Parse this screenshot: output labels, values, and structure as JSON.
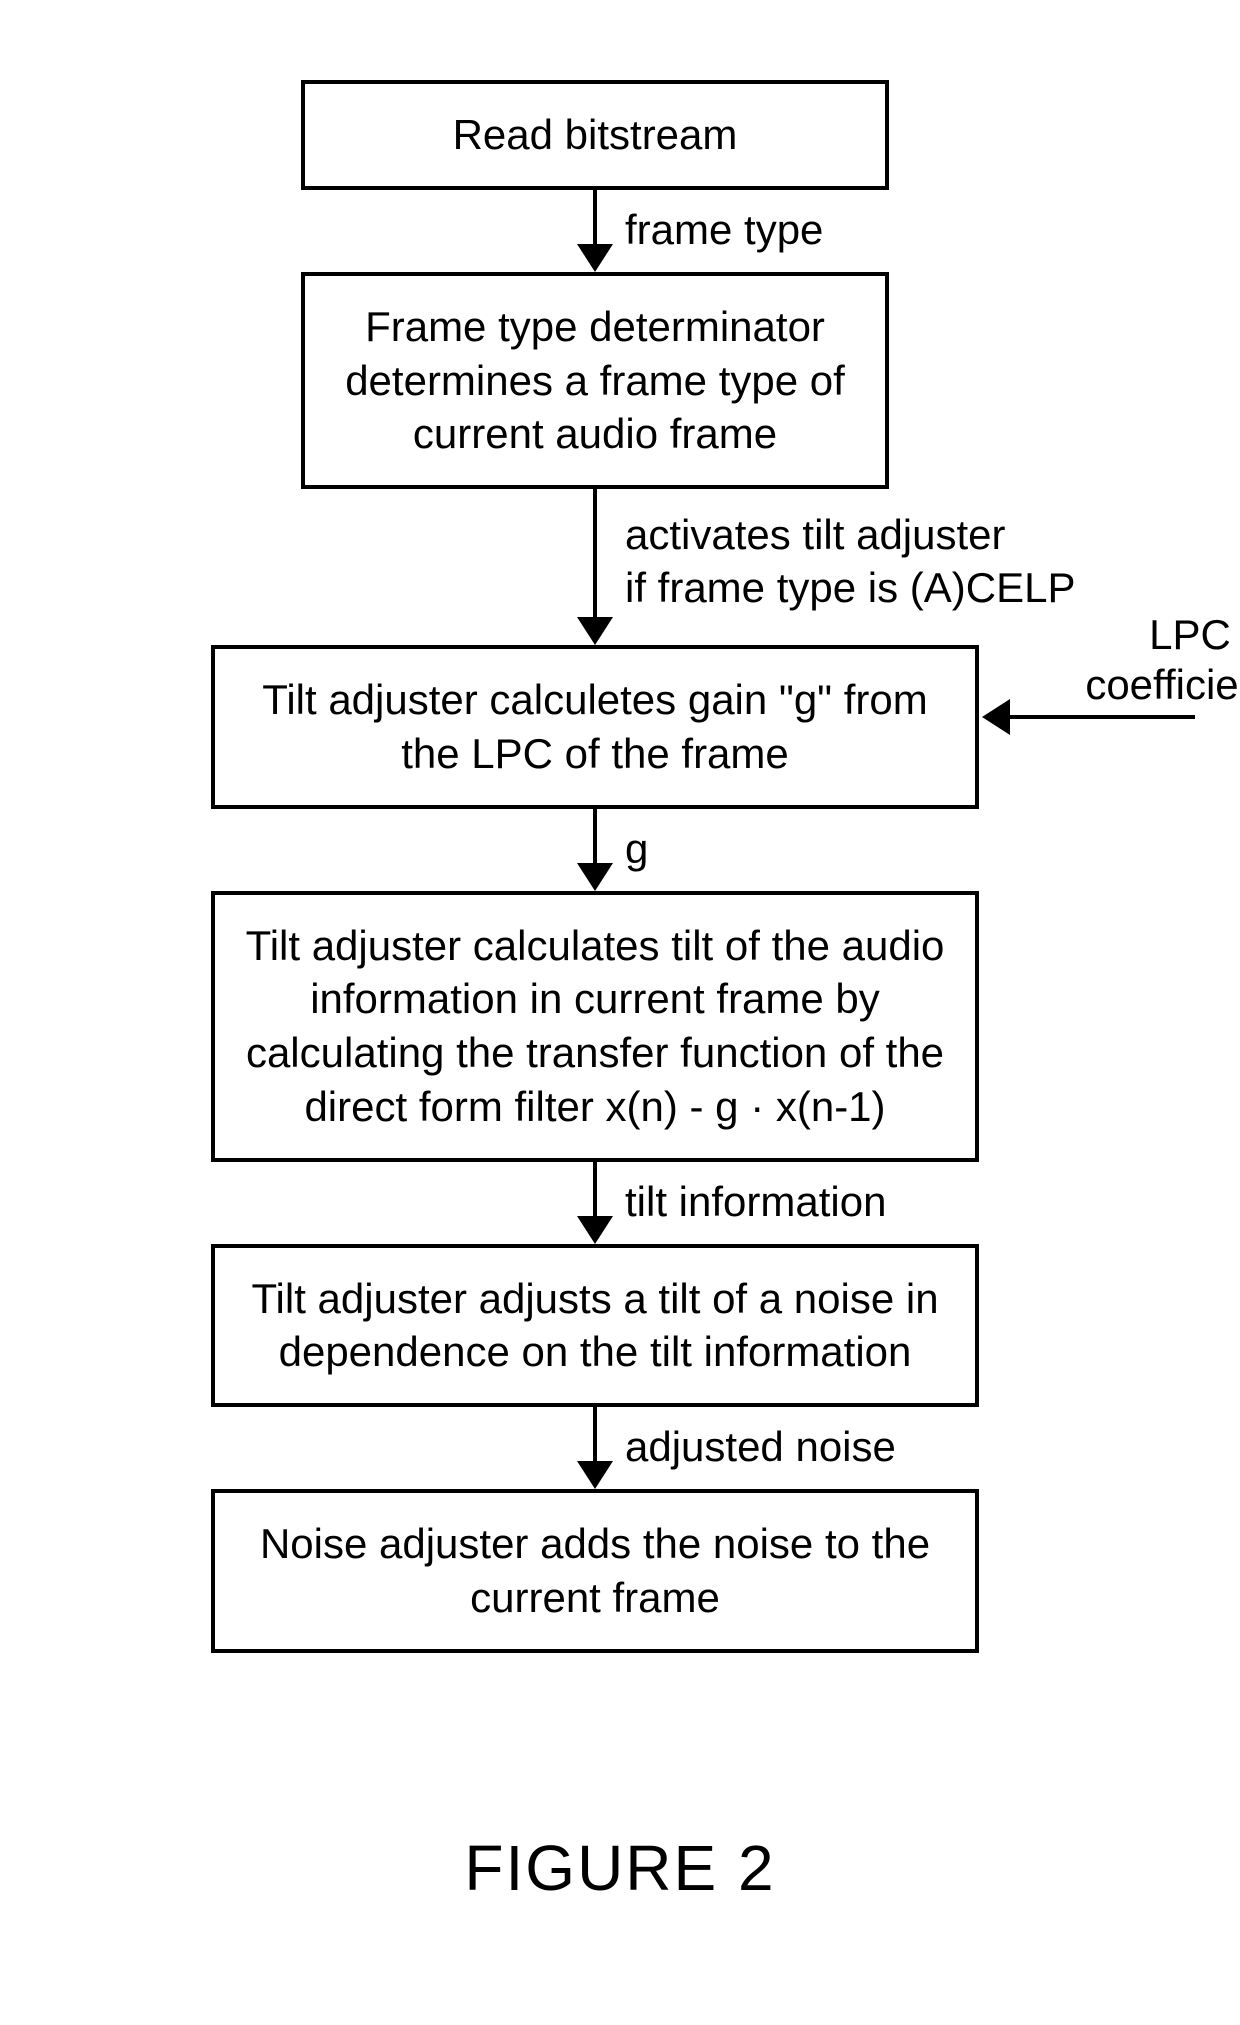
{
  "figure_caption": "FIGURE 2",
  "boxes": {
    "read_bitstream": "Read bitstream",
    "frame_type_det": "Frame type determinator\ndetermines a frame type\nof current audio frame",
    "tilt_gain": "Tilt adjuster calculetes gain \"g\"\nfrom the LPC of the frame",
    "tilt_calc": "Tilt adjuster calculates tilt of the\naudio information in current frame\nby calculating the transfer function\nof the direct form filter\nx(n) - g · x(n-1)",
    "tilt_adjust": "Tilt adjuster adjusts a tilt of a noise\nin dependence on the tilt information",
    "noise_add": "Noise adjuster adds the noise\nto the current frame"
  },
  "arrows": {
    "a1": "frame type",
    "a2": "activates tilt adjuster\nif frame type is (A)CELP",
    "a3": "g",
    "a4": "tilt information",
    "a5": "adjusted noise"
  },
  "side_input": "LPC\ncoefficients"
}
